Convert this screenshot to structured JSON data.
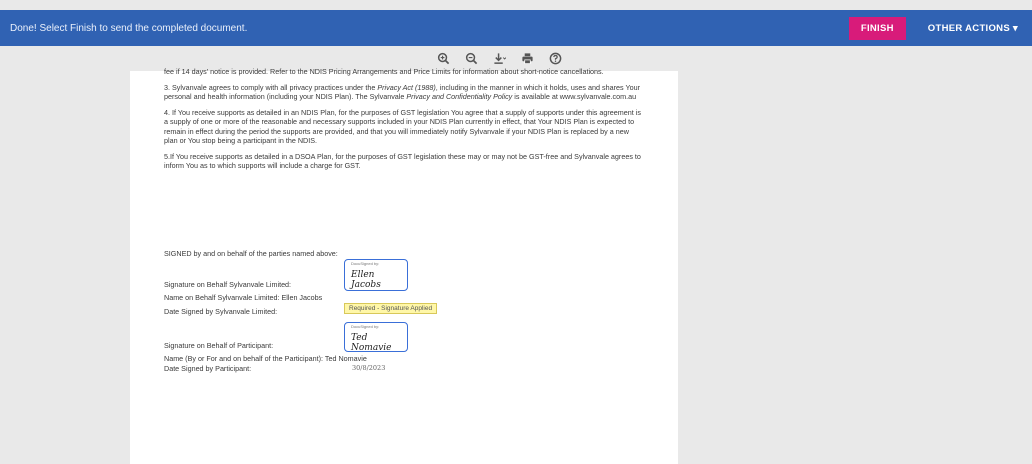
{
  "topbar": {
    "message": "Done! Select Finish to send the completed document.",
    "finish_label": "FINISH",
    "other_actions_label": "OTHER ACTIONS ▾"
  },
  "toolbar": {
    "icons": [
      "zoom-in-icon",
      "zoom-out-icon",
      "download-icon",
      "print-icon",
      "help-icon"
    ]
  },
  "document": {
    "para0": "fee if 14 days' notice is provided. Refer to the NDIS Pricing Arrangements and Price Limits for information about short-notice cancellations.",
    "para3_start": "3. Sylvanvale agrees to comply with all privacy practices under the ",
    "para3_privacy_act": "Privacy Act (1988)",
    "para3_mid": ", including in the manner in which it holds, uses and shares Your personal and health information (including your NDIS Plan). The Sylvanvale ",
    "para3_policy": "Privacy and Confidentiality Policy",
    "para3_end": " is available at www.sylvanvale.com.au",
    "para4": "4. If You receive supports as detailed in an NDIS Plan, for the purposes of GST legislation You agree that a supply of supports under this agreement is a supply of one or more of the reasonable and necessary supports included in your NDIS Plan currently in effect, that Your NDIS Plan is expected to remain in effect during the period the supports are provided, and that you will immediately notify Sylvanvale if your NDIS Plan is replaced by a new plan or You stop being a participant in the NDIS.",
    "para5": "5.If You receive supports as detailed in a DSOA Plan, for the purposes of GST legislation these may or may not be GST-free and Sylvanvale agrees to inform You as to which supports will include a charge for GST.",
    "signed_line": "SIGNED by and on behalf of the parties named above:",
    "sig_behalf_label": "Signature on Behalf Sylvanvale Limited:",
    "name_behalf_label": "Name on Behalf Sylvanvale Limited: Ellen Jacobs",
    "date_sylv_label": "Date Signed by Sylvanvale Limited:",
    "sig_participant_label": "Signature on Behalf of Participant:",
    "name_participant_label": "Name (By or For and on behalf of the Participant): Ted Nomavie",
    "date_participant_label": "Date Signed by Participant:",
    "date_participant_value": "30/8/2023",
    "sig1_caption": "DocuSigned by:",
    "sig1_value": "Ellen Jacobs",
    "sig2_caption": "DocuSigned by:",
    "sig2_value": "Ted Nomavie",
    "tooltip": "Required - Signature Applied"
  }
}
